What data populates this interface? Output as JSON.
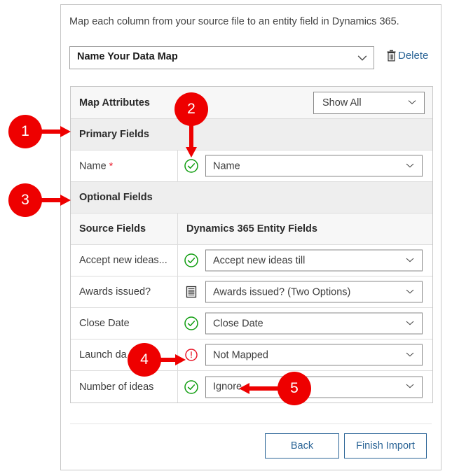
{
  "instruction": "Map each column from your source file to an entity field in Dynamics 365.",
  "map_name": {
    "value": "Name Your Data Map",
    "delete_label": "Delete",
    "delete_icon": "trash-icon",
    "chevron_icon": "chevron-down-icon"
  },
  "toolbar": {
    "title": "Map Attributes",
    "filter_value": "Show All"
  },
  "groups": {
    "primary": "Primary Fields",
    "optional": "Optional Fields"
  },
  "table_headers": {
    "source": "Source Fields",
    "target": "Dynamics 365 Entity Fields"
  },
  "primary_rows": [
    {
      "source": "Name",
      "required": true,
      "required_marker": "*",
      "status_icon": "check-circle-icon",
      "status": "mapped",
      "target": "Name"
    }
  ],
  "optional_rows": [
    {
      "source": "Accept new ideas...",
      "status_icon": "check-circle-icon",
      "status": "mapped",
      "target": "Accept new ideas till"
    },
    {
      "source": "Awards issued?",
      "status_icon": "list-options-icon",
      "status": "option-set",
      "target": "Awards issued? (Two Options)"
    },
    {
      "source": "Close Date",
      "status_icon": "check-circle-icon",
      "status": "mapped",
      "target": "Close Date"
    },
    {
      "source": "Launch da",
      "status_icon": "error-circle-icon",
      "status": "not-mapped",
      "target": "Not Mapped"
    },
    {
      "source": "Number of ideas",
      "status_icon": "check-circle-icon",
      "status": "mapped",
      "target": "Ignore"
    }
  ],
  "footer": {
    "back_label": "Back",
    "finish_label": "Finish Import"
  },
  "annotations": [
    {
      "number": "1",
      "points_to": "Primary Fields",
      "direction": "right"
    },
    {
      "number": "2",
      "points_to": "Name status icon",
      "direction": "down"
    },
    {
      "number": "3",
      "points_to": "Optional Fields",
      "direction": "right"
    },
    {
      "number": "4",
      "points_to": "Launch date error icon",
      "direction": "right"
    },
    {
      "number": "5",
      "points_to": "Ignore value",
      "direction": "left"
    }
  ],
  "colors": {
    "annotation_red": "#ee0000",
    "link_blue": "#2a6496",
    "success_green": "#107c10",
    "error_red": "#e81123",
    "group_header_bg": "#eeeeee"
  }
}
